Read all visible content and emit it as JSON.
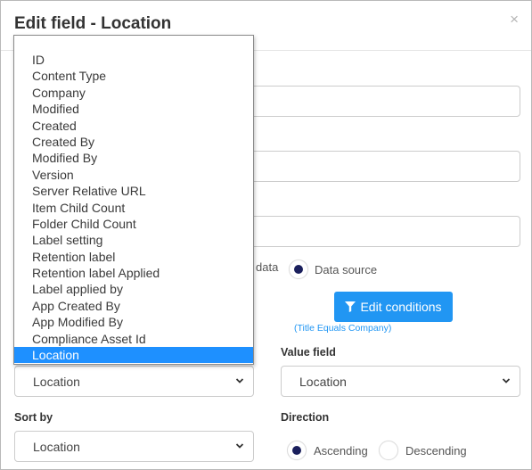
{
  "dialog": {
    "title": "Edit field - Location",
    "close_glyph": "×"
  },
  "data_mode": {
    "partial_label_left": "data",
    "option_datasource": "Data source",
    "datasource_selected": true
  },
  "conditions": {
    "button_label": "Edit conditions",
    "summary": "(Title Equals Company)"
  },
  "display_field": {
    "value": "Location"
  },
  "value_field": {
    "label": "Value field",
    "value": "Location"
  },
  "sort_by": {
    "label": "Sort by",
    "value": "Location"
  },
  "direction": {
    "label": "Direction",
    "ascending": "Ascending",
    "descending": "Descending",
    "selected": "Ascending"
  },
  "dropdown": {
    "items": [
      "ID",
      "Content Type",
      "Company",
      "Modified",
      "Created",
      "Created By",
      "Modified By",
      "Version",
      "Server Relative URL",
      "Item Child Count",
      "Folder Child Count",
      "Label setting",
      "Retention label",
      "Retention label Applied",
      "Label applied by",
      "App Created By",
      "App Modified By",
      "Compliance Asset Id",
      "Location"
    ],
    "selected": "Location"
  },
  "colors": {
    "accent": "#2196f3",
    "selection": "#1e90ff",
    "radio_dot": "#1a1f5c"
  }
}
